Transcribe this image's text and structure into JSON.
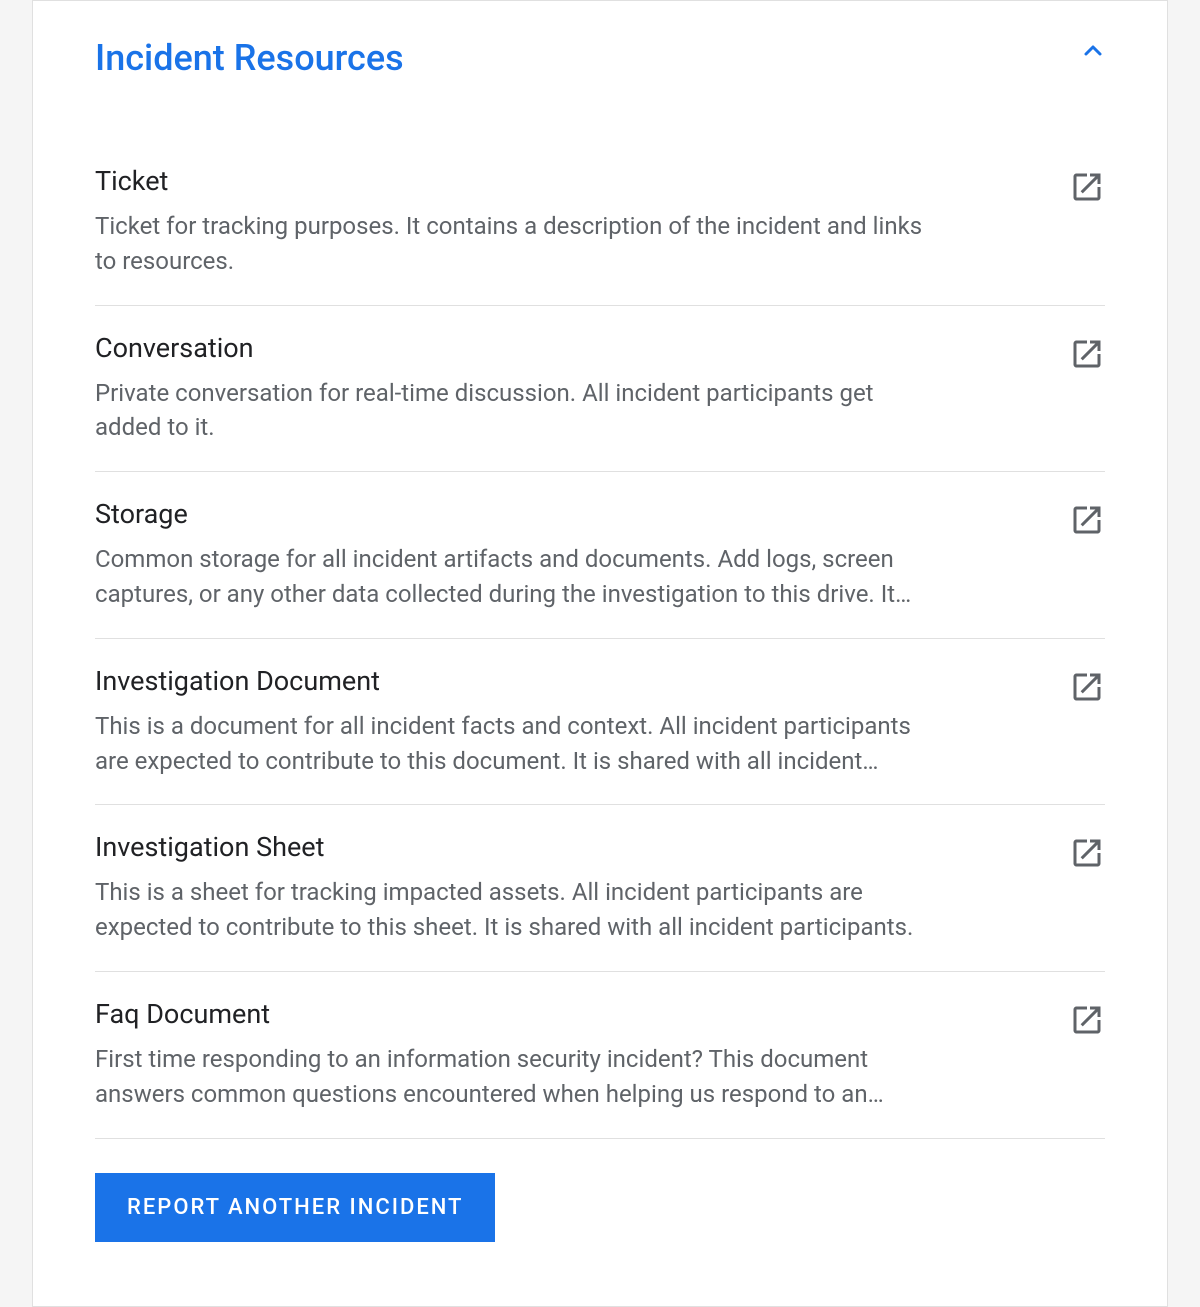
{
  "section": {
    "title": "Incident Resources"
  },
  "resources": [
    {
      "title": "Ticket",
      "description": "Ticket for tracking purposes. It contains a description of the incident and links to resources."
    },
    {
      "title": "Conversation",
      "description": "Private conversation for real-time discussion. All incident participants get added to it."
    },
    {
      "title": "Storage",
      "description": "Common storage for all incident artifacts and documents. Add logs, screen captures, or any other data collected during the investigation to this drive. It is…"
    },
    {
      "title": "Investigation Document",
      "description": "This is a document for all incident facts and context. All incident participants are expected to contribute to this document. It is shared with all incident…"
    },
    {
      "title": "Investigation Sheet",
      "description": "This is a sheet for tracking impacted assets. All incident participants are expected to contribute to this sheet. It is shared with all incident participants."
    },
    {
      "title": "Faq Document",
      "description": "First time responding to an information security incident? This document answers common questions encountered when helping us respond to an…"
    }
  ],
  "actions": {
    "report_button_label": "REPORT ANOTHER INCIDENT"
  }
}
